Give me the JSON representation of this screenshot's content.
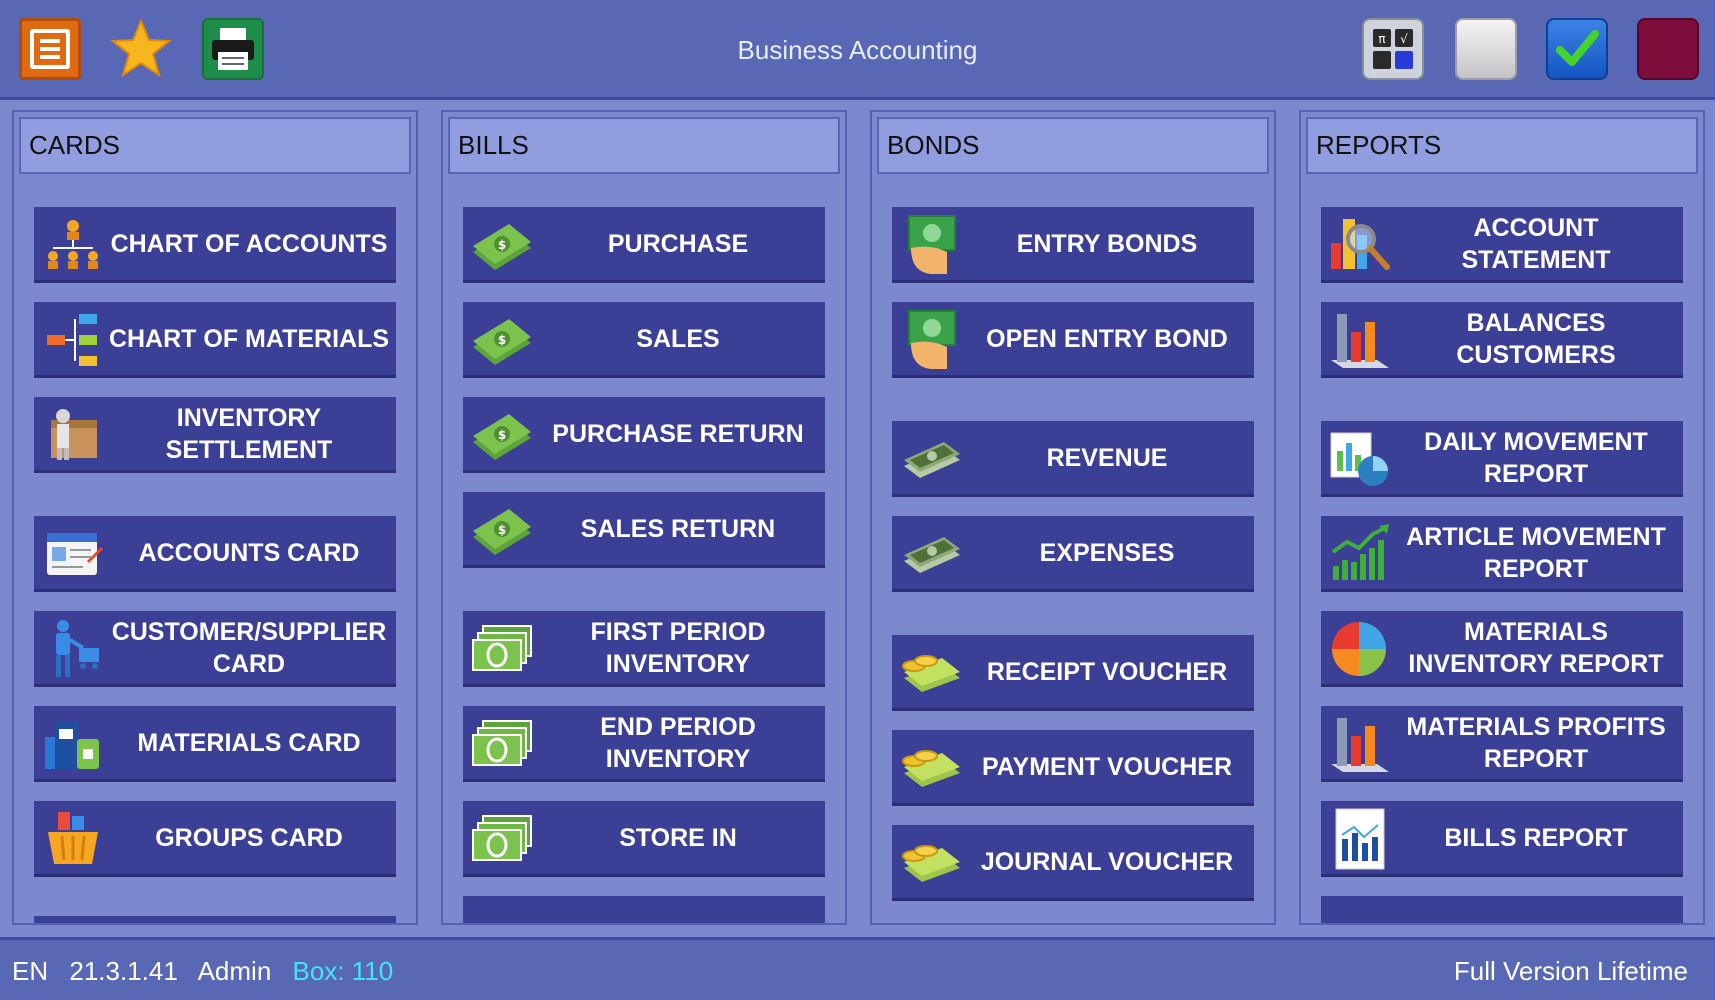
{
  "app": {
    "title": "Business Accounting"
  },
  "toolbar": {
    "menu_icon": "menu-icon",
    "favorites_icon": "star-icon",
    "print_icon": "printer-icon",
    "calculator_icon": "calculator-icon",
    "blank_icon": "blank-button-icon",
    "check_icon": "checkmark-icon",
    "exit_icon": "exit-icon"
  },
  "colors": {
    "accent": "#3b3f95",
    "background": "#7c89cf",
    "header": "#909ddf",
    "topbar": "#5868b5",
    "box_highlight": "#41e3ff"
  },
  "columns": {
    "cards": {
      "title": "CARDS",
      "items": [
        {
          "label": "CHART OF ACCOUNTS",
          "icon": "org-chart-icon"
        },
        {
          "label": "CHART OF MATERIALS",
          "icon": "tree-structure-icon"
        },
        {
          "label": "INVENTORY\nSETTLEMENT",
          "icon": "inventory-boxes-icon"
        },
        {
          "label": "ACCOUNTS CARD",
          "icon": "id-card-icon"
        },
        {
          "label": "CUSTOMER/SUPPLIER\nCARD",
          "icon": "shopper-icon"
        },
        {
          "label": "MATERIALS CARD",
          "icon": "products-icon"
        },
        {
          "label": "GROUPS CARD",
          "icon": "basket-icon"
        }
      ]
    },
    "bills": {
      "title": "BILLS",
      "items": [
        {
          "label": "PURCHASE",
          "icon": "money-icon"
        },
        {
          "label": "SALES",
          "icon": "money-icon"
        },
        {
          "label": "PURCHASE RETURN",
          "icon": "money-icon"
        },
        {
          "label": "SALES RETURN",
          "icon": "money-icon"
        },
        {
          "label": "FIRST PERIOD\nINVENTORY",
          "icon": "banknotes-icon"
        },
        {
          "label": "END PERIOD\nINVENTORY",
          "icon": "banknotes-icon"
        },
        {
          "label": "STORE IN",
          "icon": "banknotes-icon"
        }
      ]
    },
    "bonds": {
      "title": "BONDS",
      "items": [
        {
          "label": "ENTRY BONDS",
          "icon": "cash-hand-icon"
        },
        {
          "label": "OPEN ENTRY BOND",
          "icon": "cash-hand-icon"
        },
        {
          "label": "REVENUE",
          "icon": "cash-stack-icon"
        },
        {
          "label": "EXPENSES",
          "icon": "cash-stack-icon"
        },
        {
          "label": "RECEIPT VOUCHER",
          "icon": "coins-cash-icon"
        },
        {
          "label": "PAYMENT VOUCHER",
          "icon": "coins-cash-icon"
        },
        {
          "label": "JOURNAL VOUCHER",
          "icon": "coins-cash-icon"
        }
      ]
    },
    "reports": {
      "title": "REPORTS",
      "items": [
        {
          "label": "ACCOUNT\nSTATEMENT",
          "icon": "magnifier-chart-icon"
        },
        {
          "label": "BALANCES\nCUSTOMERS",
          "icon": "bar-chart-icon"
        },
        {
          "label": "DAILY MOVEMENT\nREPORT",
          "icon": "pie-report-icon"
        },
        {
          "label": "ARTICLE MOVEMENT\nREPORT",
          "icon": "growth-chart-icon"
        },
        {
          "label": "MATERIALS\nINVENTORY REPORT",
          "icon": "pie-chart-icon"
        },
        {
          "label": "MATERIALS PROFITS\nREPORT",
          "icon": "bar-chart-icon"
        },
        {
          "label": "BILLS REPORT",
          "icon": "report-sheet-icon"
        }
      ]
    }
  },
  "status": {
    "language": "EN",
    "version": "21.3.1.41",
    "user": "Admin",
    "box": "Box: 110",
    "license": "Full Version Lifetime"
  }
}
